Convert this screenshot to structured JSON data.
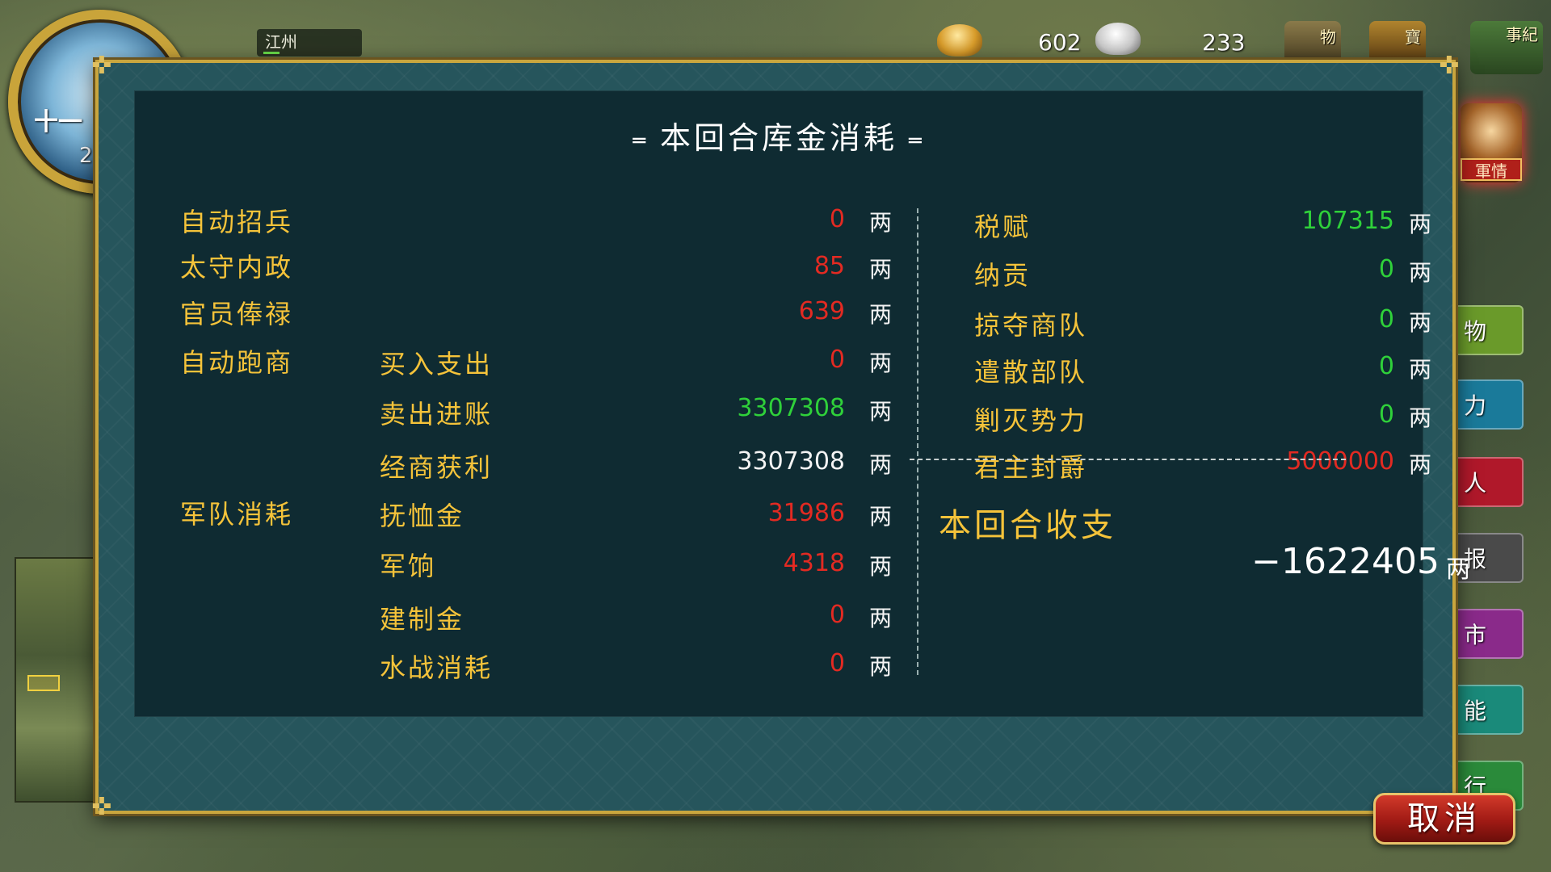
{
  "topbar": {
    "region": "江州",
    "gold": "602",
    "food": "233",
    "buttons": [
      "物",
      "寶",
      "事紀"
    ]
  },
  "emblem": {
    "label": "十一",
    "year": "2"
  },
  "side": {
    "junqing": "軍情",
    "buttons": [
      {
        "label": "物",
        "color": "#6a9a2a"
      },
      {
        "label": "力",
        "color": "#1a7a9a"
      },
      {
        "label": "人",
        "color": "#b0182a"
      },
      {
        "label": "报",
        "color": "#4a4a4a"
      },
      {
        "label": "市",
        "color": "#8a2a8a"
      },
      {
        "label": "能",
        "color": "#1a8a7a"
      },
      {
        "label": "行",
        "color": "#2a8a3a"
      }
    ]
  },
  "dialog": {
    "title": "本回合库金消耗",
    "title_dash": "═",
    "unit": "两",
    "expenses": [
      {
        "category": "自动招兵",
        "sub": "",
        "value": "0",
        "color": "red"
      },
      {
        "category": "太守内政",
        "sub": "",
        "value": "85",
        "color": "red"
      },
      {
        "category": "官员俸禄",
        "sub": "",
        "value": "639",
        "color": "red"
      },
      {
        "category": "自动跑商",
        "sub": "买入支出",
        "value": "0",
        "color": "red"
      },
      {
        "category": "",
        "sub": "卖出进账",
        "value": "3307308",
        "color": "green"
      },
      {
        "category": "",
        "sub": "经商获利",
        "value": "3307308",
        "color": "white"
      },
      {
        "category": "军队消耗",
        "sub": "抚恤金",
        "value": "31986",
        "color": "red"
      },
      {
        "category": "",
        "sub": "军饷",
        "value": "4318",
        "color": "red"
      },
      {
        "category": "",
        "sub": "建制金",
        "value": "0",
        "color": "red"
      },
      {
        "category": "",
        "sub": "水战消耗",
        "value": "0",
        "color": "red"
      }
    ],
    "income": [
      {
        "label": "税赋",
        "value": "107315",
        "color": "green"
      },
      {
        "label": "纳贡",
        "value": "0",
        "color": "green"
      },
      {
        "label": "掠夺商队",
        "value": "0",
        "color": "green"
      },
      {
        "label": "遣散部队",
        "value": "0",
        "color": "green"
      },
      {
        "label": "剿灭势力",
        "value": "0",
        "color": "green"
      },
      {
        "label": "君主封爵",
        "value": "5000000",
        "color": "red"
      }
    ],
    "summary": {
      "label": "本回合收支",
      "value": "−1622405"
    },
    "cancel": "取消"
  }
}
